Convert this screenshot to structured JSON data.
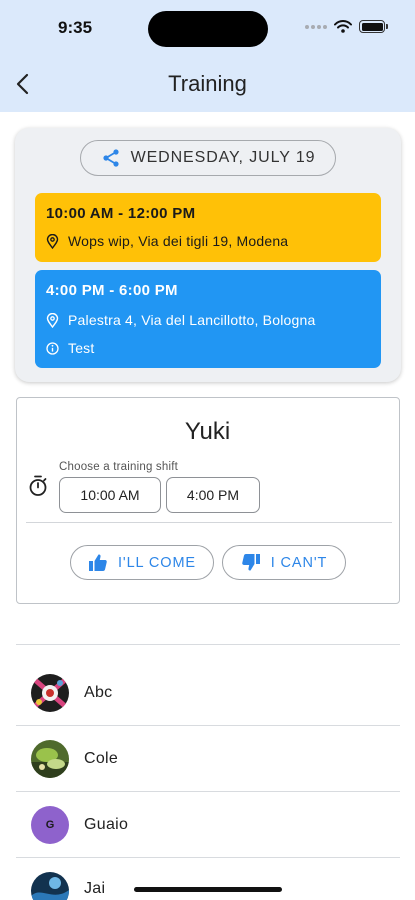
{
  "status_bar": {
    "time": "9:35"
  },
  "header": {
    "title": "Training"
  },
  "schedule": {
    "date": "WEDNESDAY, JULY 19",
    "slots": [
      {
        "hours": "10:00 AM - 12:00 PM",
        "location": "Wops wip, Via dei tigli 19, Modena",
        "color": "#ffc107"
      },
      {
        "hours": "4:00 PM - 6:00 PM",
        "location": "Palestra 4, Via del Lancillotto, Bologna",
        "note": "Test",
        "color": "#2196f3"
      }
    ]
  },
  "attendance": {
    "name": "Yuki",
    "shift_label": "Choose a training shift",
    "shifts": [
      "10:00 AM",
      "4:00 PM"
    ],
    "come_label": "I'LL COME",
    "cant_label": "I CAN'T",
    "accent": "#2d86e8"
  },
  "members": [
    {
      "name": "Abc"
    },
    {
      "name": "Cole"
    },
    {
      "name": "Guaio",
      "initial": "G"
    },
    {
      "name": "Jai"
    }
  ]
}
